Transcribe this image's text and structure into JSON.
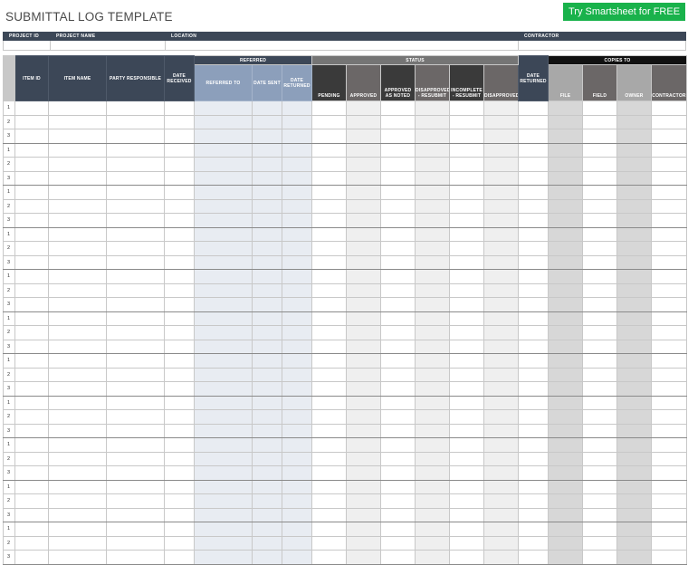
{
  "title": "SUBMITTAL LOG TEMPLATE",
  "cta": "Try Smartsheet for FREE",
  "info_headers": [
    "PROJECT ID",
    "PROJECT NAME",
    "LOCATION",
    "CONTRACTOR"
  ],
  "headers": {
    "item_id": "ITEM ID",
    "item_name": "ITEM NAME",
    "party": "PARTY RESPONSIBLE",
    "date_received": "DATE RECEIVED",
    "referred": "REFERRED",
    "referred_to": "REFERRED TO",
    "date_sent": "DATE SENT",
    "ref_date_returned": "DATE RETURNED",
    "status": "STATUS",
    "pending": "PENDING",
    "approved": "APPROVED",
    "approved_noted": "APPROVED AS NOTED",
    "disapproved_resubmit": "DISAPPROVED - RESUBMIT",
    "incomplete_resubmit": "INCOMPLETE - RESUBMIT",
    "disapproved": "DISAPPROVED",
    "date_returned": "DATE RETURNED",
    "copies_to": "COPIES TO",
    "file": "FILE",
    "field": "FIELD",
    "owner": "OWNER",
    "contractor": "CONTRACTOR"
  },
  "row_numbers": [
    "1",
    "2",
    "3",
    "1",
    "2",
    "3",
    "1",
    "2",
    "3",
    "1",
    "2",
    "3",
    "1",
    "2",
    "3",
    "1",
    "2",
    "3",
    "1",
    "2",
    "3",
    "1",
    "2",
    "3",
    "1",
    "2",
    "3",
    "1",
    "2",
    "3",
    "1",
    "2",
    "3"
  ],
  "colors": {
    "cta": "#19b24b",
    "header_dark": "#3c4757",
    "referred_sub": "#8c9fbb",
    "status_dark": "#3a3a3a",
    "status_mid": "#6b6767"
  }
}
